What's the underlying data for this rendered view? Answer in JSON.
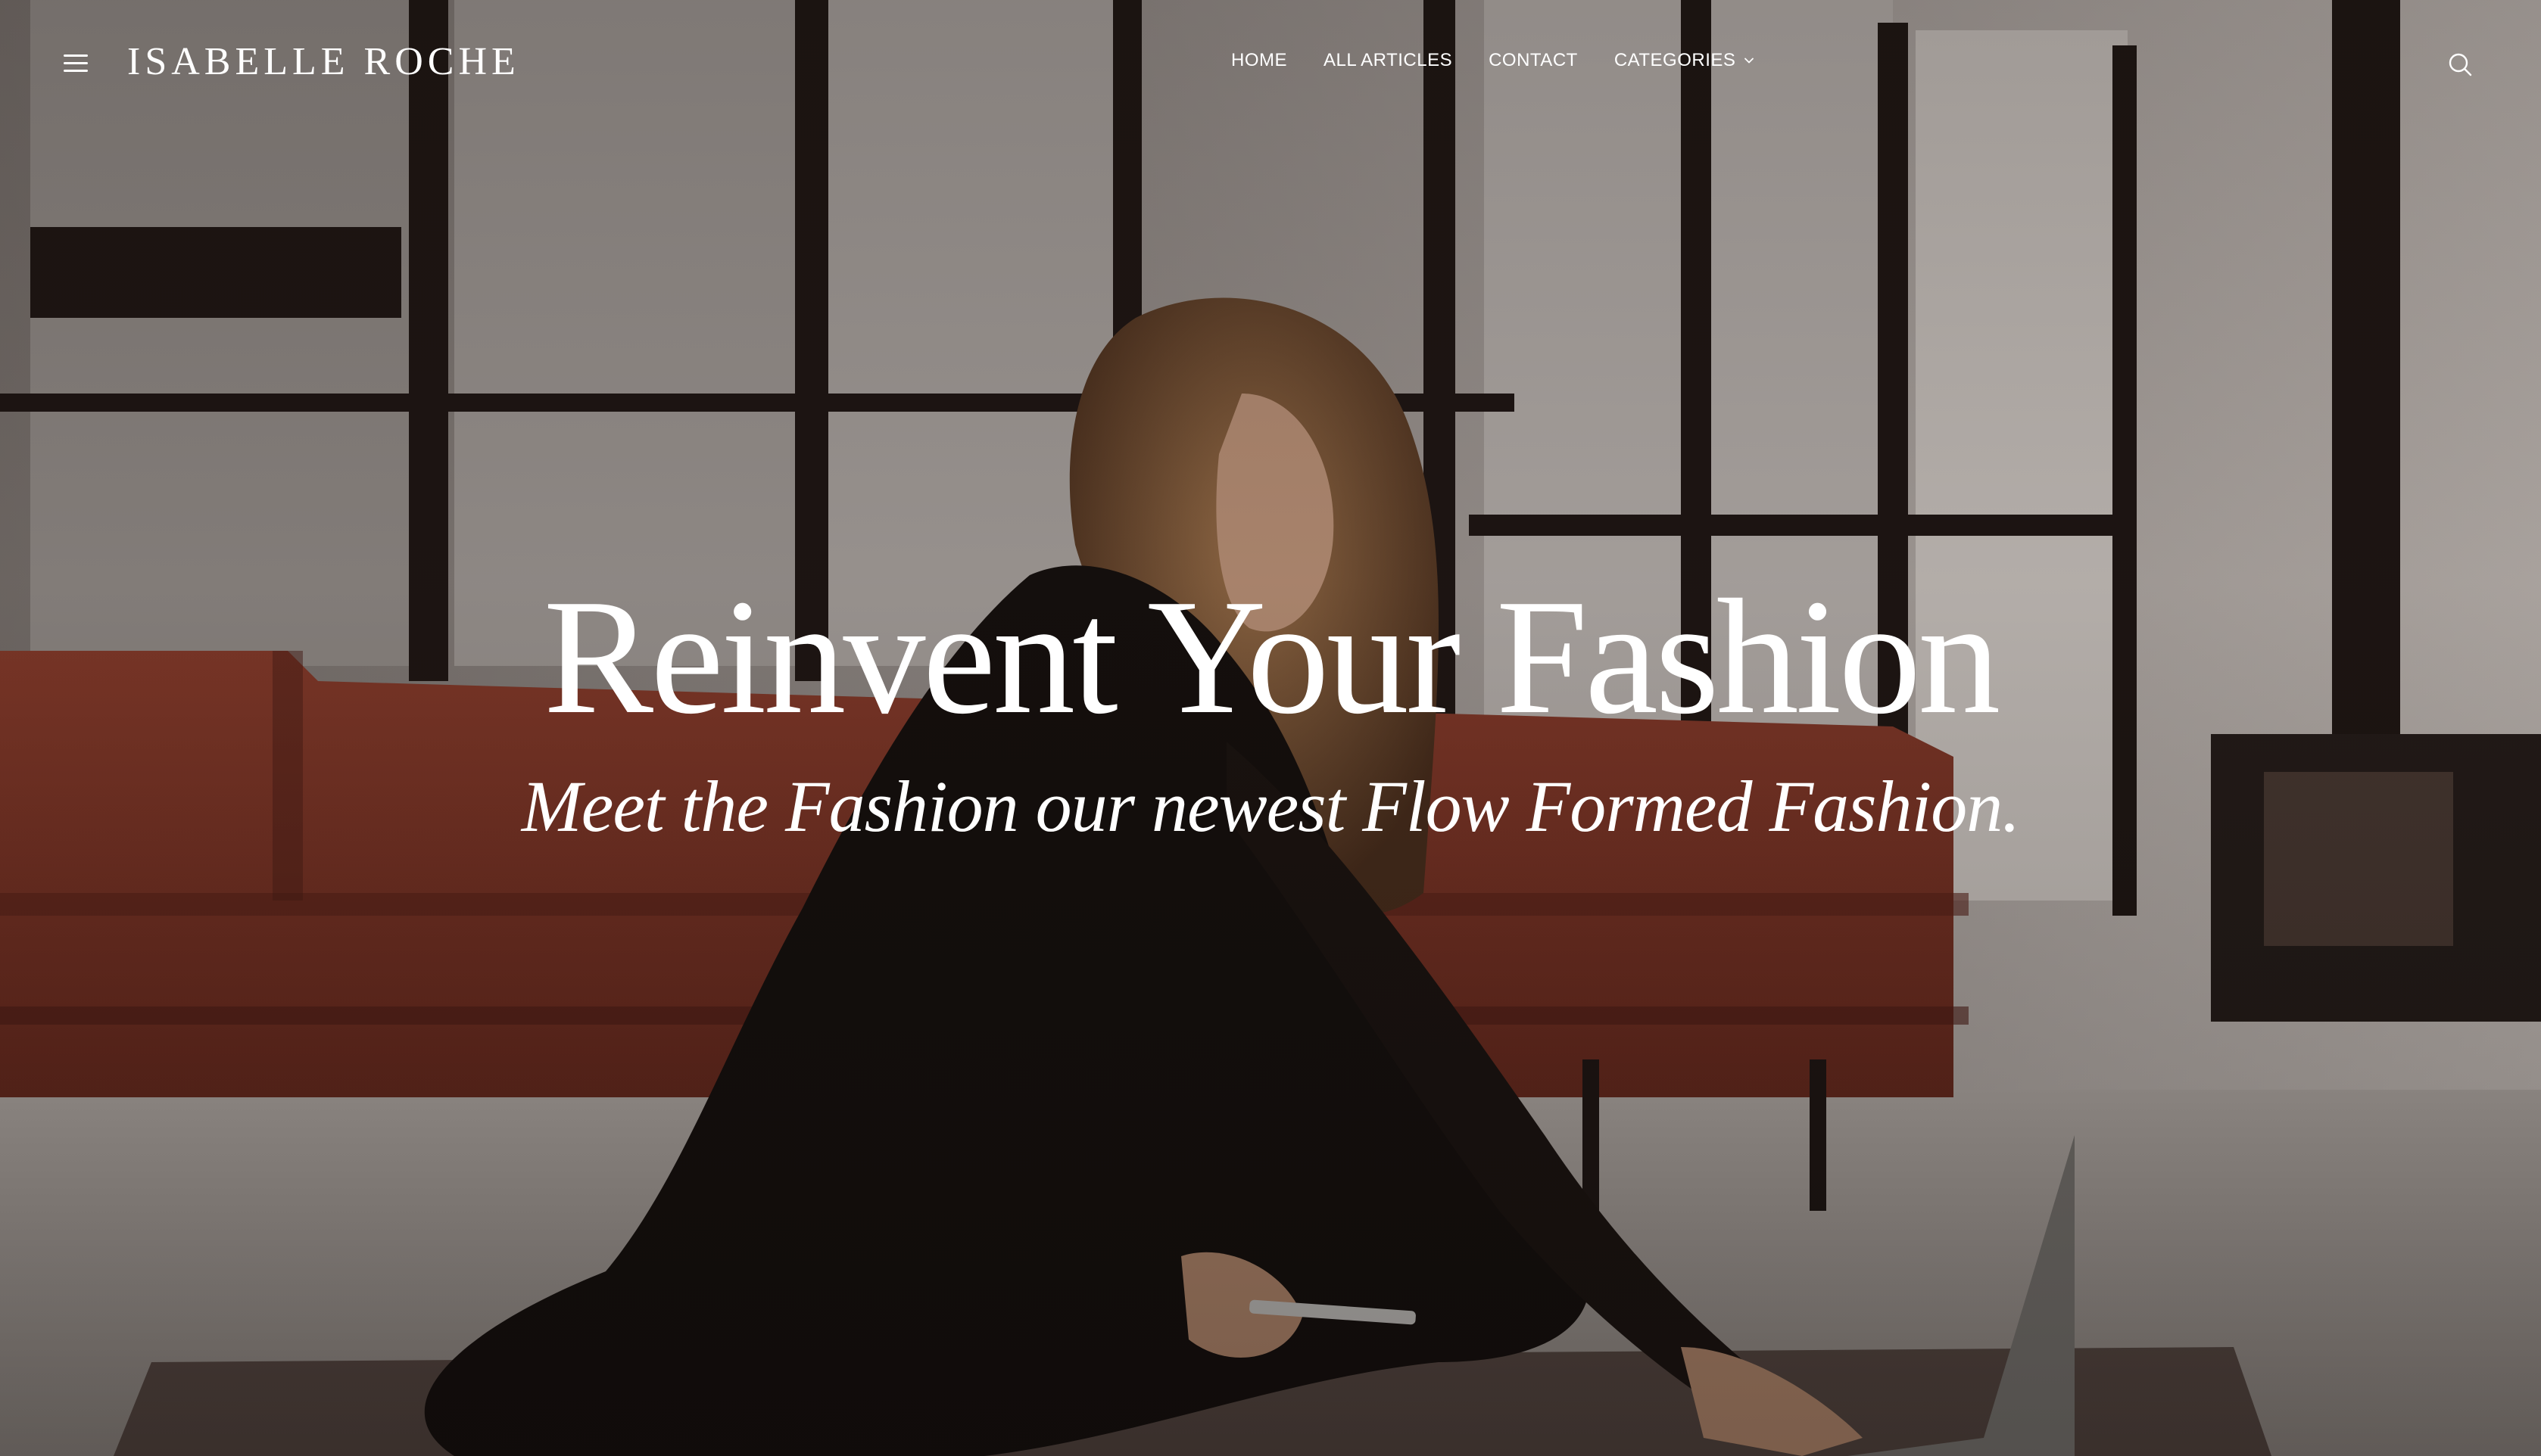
{
  "site": {
    "logo": "ISABELLE ROCHE"
  },
  "nav": {
    "items": [
      {
        "label": "HOME"
      },
      {
        "label": "ALL ARTICLES"
      },
      {
        "label": "CONTACT"
      },
      {
        "label": "CATEGORIES",
        "has_dropdown": true
      }
    ]
  },
  "header_icons": {
    "menu": "hamburger-menu-icon",
    "search": "search-icon",
    "dropdown": "chevron-down-icon"
  },
  "hero": {
    "title": "Reinvent Your Fashion",
    "subtitle": "Meet the Fashion our newest Flow Formed Fashion."
  },
  "colors": {
    "text": "#ffffff",
    "sofa": "#8a3a2a",
    "window_frame": "#1e1613",
    "wall": "#cfc9c4"
  }
}
